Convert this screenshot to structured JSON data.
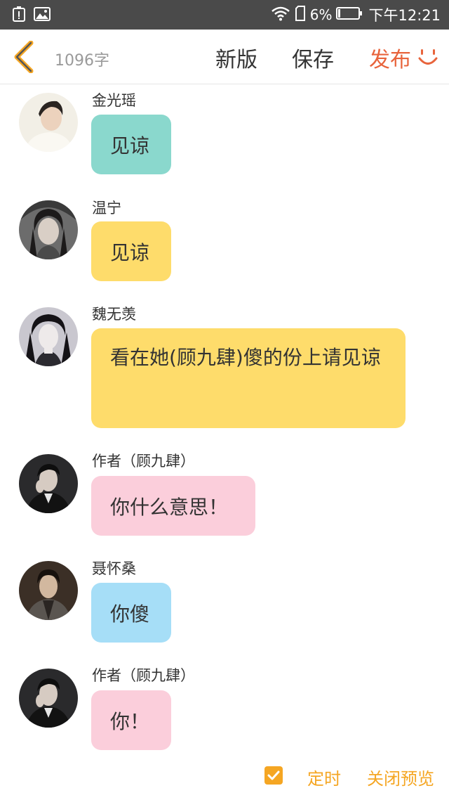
{
  "status_bar": {
    "battery_percent": "6%",
    "time": "下午12:21",
    "icons": [
      "battery-alert-icon",
      "image-icon",
      "wifi-icon",
      "sim-icon",
      "battery-icon"
    ]
  },
  "toolbar": {
    "word_count": "1096字",
    "new_version_label": "新版",
    "save_label": "保存",
    "publish_label": "发布"
  },
  "colors": {
    "teal": "#8ad8cd",
    "yellow": "#fedc6b",
    "pink": "#fbcedb",
    "blue": "#a6def7",
    "accent_orange": "#f5a623",
    "publish_red": "#e8643c"
  },
  "messages": [
    {
      "sender": "金光瑶",
      "text": "见谅",
      "bubble_color": "#8ad8cd"
    },
    {
      "sender": "温宁",
      "text": "见谅",
      "bubble_color": "#fedc6b"
    },
    {
      "sender": "魏无羡",
      "text": "看在她(顾九肆)傻的份上请见谅",
      "bubble_color": "#fedc6b"
    },
    {
      "sender": "作者（顾九肆）",
      "text": "你什么意思！",
      "bubble_color": "#fbcedb"
    },
    {
      "sender": "聂怀桑",
      "text": "你傻",
      "bubble_color": "#a6def7"
    },
    {
      "sender": "作者（顾九肆）",
      "text": "你！",
      "bubble_color": "#fbcedb"
    }
  ],
  "bottom_bar": {
    "timer_checked": true,
    "timer_label": "定时",
    "close_preview_label": "关闭预览"
  }
}
